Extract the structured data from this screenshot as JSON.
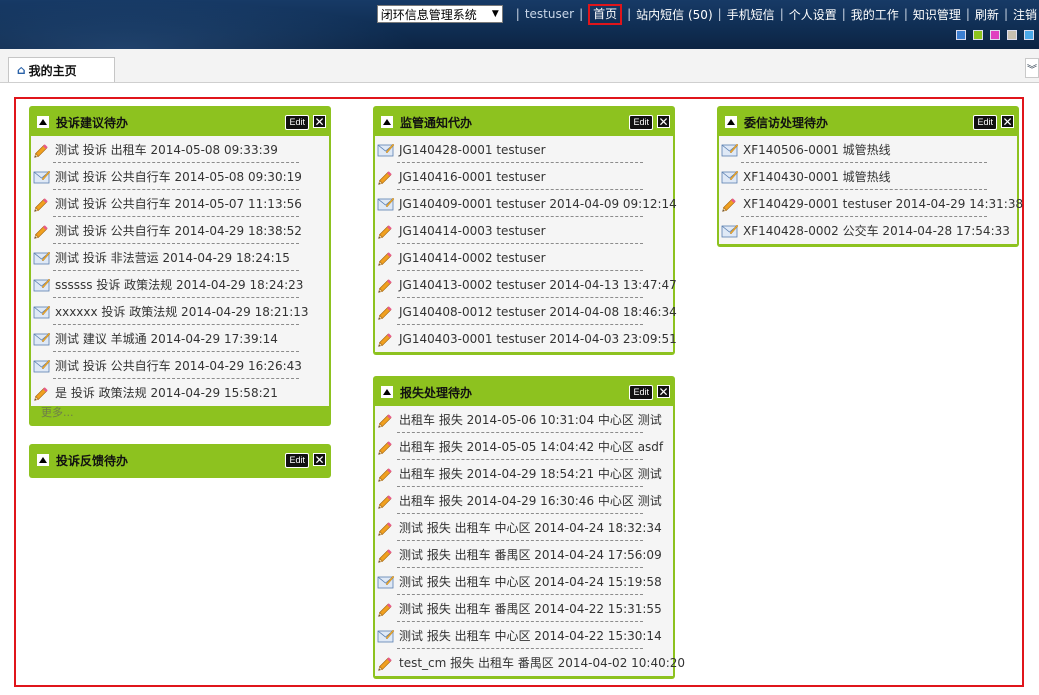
{
  "header": {
    "system_select": "闭环信息管理系统",
    "username": "testuser",
    "nav": [
      "首页",
      "站内短信 (50)",
      "手机短信",
      "个人设置",
      "我的工作",
      "知识管理",
      "刷新",
      "注销"
    ],
    "theme_colors": [
      "#3d7fd1",
      "#8dc21f",
      "#e040c0",
      "#c8c0b0",
      "#4aa8e8"
    ]
  },
  "tab": {
    "label": "我的主页"
  },
  "portlets": {
    "complaint_suggestion": {
      "title": "投诉建议待办",
      "edit_label": "Edit",
      "more_label": "更多...",
      "items": [
        {
          "icon": "pencil-icon",
          "text": "测试 投诉 出租车 2014-05-08 09:33:39"
        },
        {
          "icon": "mail-icon",
          "text": "测试 投诉 公共自行车 2014-05-08 09:30:19"
        },
        {
          "icon": "pencil-icon",
          "text": "测试 投诉 公共自行车 2014-05-07 11:13:56"
        },
        {
          "icon": "pencil-icon",
          "text": "测试 投诉 公共自行车 2014-04-29 18:38:52"
        },
        {
          "icon": "mail-icon",
          "text": "测试 投诉 非法营运 2014-04-29 18:24:15"
        },
        {
          "icon": "mail-icon",
          "text": "ssssss 投诉 政策法规 2014-04-29 18:24:23"
        },
        {
          "icon": "mail-icon",
          "text": "xxxxxx 投诉 政策法规 2014-04-29 18:21:13"
        },
        {
          "icon": "mail-icon",
          "text": "测试 建议 羊城通 2014-04-29 17:39:14"
        },
        {
          "icon": "mail-icon",
          "text": "测试 投诉 公共自行车 2014-04-29 16:26:43"
        },
        {
          "icon": "pencil-icon",
          "text": "是 投诉 政策法规 2014-04-29 15:58:21"
        }
      ]
    },
    "complaint_feedback": {
      "title": "投诉反馈待办",
      "edit_label": "Edit",
      "items": []
    },
    "supervision": {
      "title": "监管通知代办",
      "edit_label": "Edit",
      "items": [
        {
          "icon": "mail-icon",
          "text": "JG140428-0001 testuser"
        },
        {
          "icon": "pencil-icon",
          "text": "JG140416-0001 testuser"
        },
        {
          "icon": "mail-icon",
          "text": "JG140409-0001 testuser 2014-04-09 09:12:14"
        },
        {
          "icon": "pencil-icon",
          "text": "JG140414-0003 testuser"
        },
        {
          "icon": "pencil-icon",
          "text": "JG140414-0002 testuser"
        },
        {
          "icon": "pencil-icon",
          "text": "JG140413-0002 testuser 2014-04-13 13:47:47"
        },
        {
          "icon": "pencil-icon",
          "text": "JG140408-0012 testuser 2014-04-08 18:46:34"
        },
        {
          "icon": "pencil-icon",
          "text": "JG140403-0001 testuser 2014-04-03 23:09:51"
        }
      ]
    },
    "lost_report": {
      "title": "报失处理待办",
      "edit_label": "Edit",
      "items": [
        {
          "icon": "pencil-icon",
          "text": "出租车 报失 2014-05-06 10:31:04 中心区 测试"
        },
        {
          "icon": "pencil-icon",
          "text": "出租车 报失 2014-05-05 14:04:42 中心区 asdf"
        },
        {
          "icon": "pencil-icon",
          "text": "出租车 报失 2014-04-29 18:54:21 中心区 测试"
        },
        {
          "icon": "pencil-icon",
          "text": "出租车 报失 2014-04-29 16:30:46 中心区 测试"
        },
        {
          "icon": "pencil-icon",
          "text": "测试 报失 出租车 中心区 2014-04-24 18:32:34"
        },
        {
          "icon": "pencil-icon",
          "text": "测试 报失 出租车 番禺区 2014-04-24 17:56:09"
        },
        {
          "icon": "mail-icon",
          "text": "测试 报失 出租车 中心区 2014-04-24 15:19:58"
        },
        {
          "icon": "pencil-icon",
          "text": "测试 报失 出租车 番禺区 2014-04-22 15:31:55"
        },
        {
          "icon": "mail-icon",
          "text": "测试 报失 出租车 中心区 2014-04-22 15:30:14"
        },
        {
          "icon": "pencil-icon",
          "text": "test_cm 报失 出租车 番禺区 2014-04-02 10:40:20"
        }
      ]
    },
    "petition": {
      "title": "委信访处理待办",
      "edit_label": "Edit",
      "items": [
        {
          "icon": "mail-icon",
          "text": "XF140506-0001 城管热线"
        },
        {
          "icon": "mail-icon",
          "text": "XF140430-0001 城管热线"
        },
        {
          "icon": "pencil-icon",
          "text": "XF140429-0001 testuser 2014-04-29 14:31:38"
        },
        {
          "icon": "mail-icon",
          "text": "XF140428-0002 公交车 2014-04-28 17:54:33"
        }
      ]
    }
  }
}
